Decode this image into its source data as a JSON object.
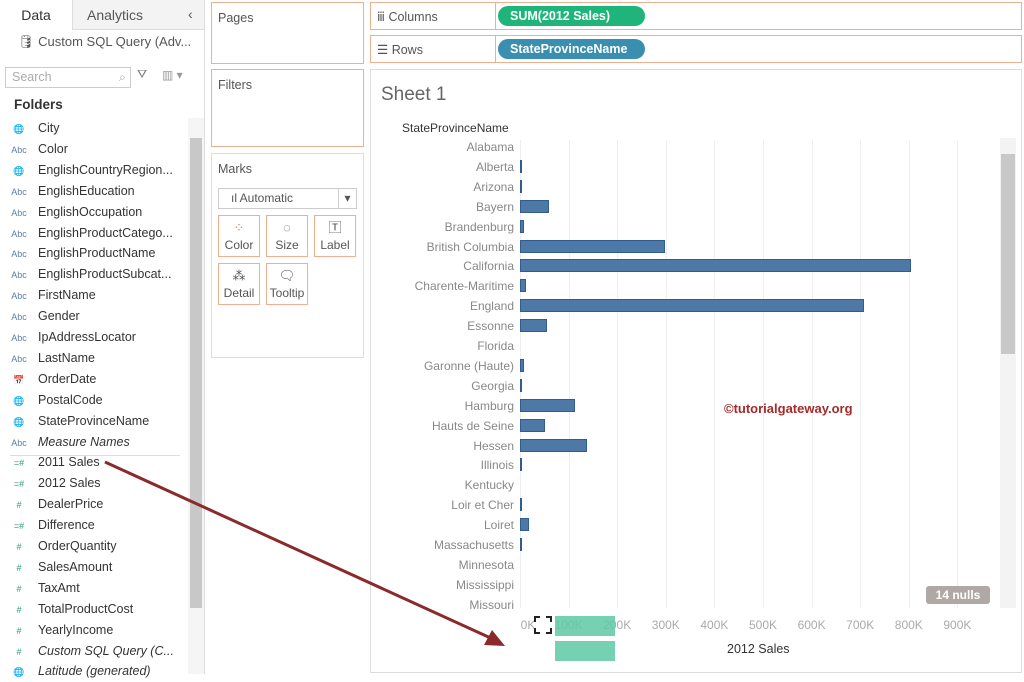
{
  "left": {
    "tabs": [
      "Data",
      "Analytics"
    ],
    "datasource": "Custom SQL Query (Adv...",
    "search_placeholder": "Search",
    "folders_label": "Folders",
    "fields": [
      {
        "icon": "globe",
        "name": "City",
        "type": "dim"
      },
      {
        "icon": "Abc",
        "name": "Color",
        "type": "dim"
      },
      {
        "icon": "globe",
        "name": "EnglishCountryRegion...",
        "type": "dim"
      },
      {
        "icon": "Abc",
        "name": "EnglishEducation",
        "type": "dim"
      },
      {
        "icon": "Abc",
        "name": "EnglishOccupation",
        "type": "dim"
      },
      {
        "icon": "Abc",
        "name": "EnglishProductCatego...",
        "type": "dim"
      },
      {
        "icon": "Abc",
        "name": "EnglishProductName",
        "type": "dim"
      },
      {
        "icon": "Abc",
        "name": "EnglishProductSubcat...",
        "type": "dim"
      },
      {
        "icon": "Abc",
        "name": "FirstName",
        "type": "dim"
      },
      {
        "icon": "Abc",
        "name": "Gender",
        "type": "dim"
      },
      {
        "icon": "Abc",
        "name": "IpAddressLocator",
        "type": "dim"
      },
      {
        "icon": "Abc",
        "name": "LastName",
        "type": "dim"
      },
      {
        "icon": "calendar",
        "name": "OrderDate",
        "type": "dim"
      },
      {
        "icon": "globe",
        "name": "PostalCode",
        "type": "dim"
      },
      {
        "icon": "globe",
        "name": "StateProvinceName",
        "type": "dim"
      },
      {
        "icon": "Abc",
        "name": "Measure Names",
        "type": "dim",
        "italic": true
      },
      {
        "icon": "=#",
        "name": "2011 Sales",
        "type": "meas"
      },
      {
        "icon": "=#",
        "name": "2012 Sales",
        "type": "meas"
      },
      {
        "icon": "#",
        "name": "DealerPrice",
        "type": "meas"
      },
      {
        "icon": "=#",
        "name": "Difference",
        "type": "meas"
      },
      {
        "icon": "#",
        "name": "OrderQuantity",
        "type": "meas"
      },
      {
        "icon": "#",
        "name": "SalesAmount",
        "type": "meas"
      },
      {
        "icon": "#",
        "name": "TaxAmt",
        "type": "meas"
      },
      {
        "icon": "#",
        "name": "TotalProductCost",
        "type": "meas"
      },
      {
        "icon": "#",
        "name": "YearlyIncome",
        "type": "meas"
      },
      {
        "icon": "#",
        "name": "Custom SQL Query (C...",
        "type": "meas",
        "italic": true
      },
      {
        "icon": "globe",
        "name": "Latitude (generated)",
        "type": "meas",
        "italic": true
      }
    ]
  },
  "cards": {
    "pages": "Pages",
    "filters": "Filters",
    "marks": "Marks",
    "mark_type": "Automatic",
    "buttons": [
      "Color",
      "Size",
      "Label",
      "Detail",
      "Tooltip"
    ]
  },
  "shelves": {
    "columns_label": "Columns",
    "columns_pill": "SUM(2012 Sales)",
    "rows_label": "Rows",
    "rows_pill": "StateProvinceName",
    "columns_color": "#1fb57a",
    "rows_color": "#3a8fb0"
  },
  "sheet": {
    "title": "Sheet 1",
    "watermark": "©tutorialgateway.org",
    "nulls": "14 nulls"
  },
  "chart_data": {
    "type": "bar",
    "orientation": "horizontal",
    "row_header": "StateProvinceName",
    "xlabel": "2012 Sales",
    "xlim": [
      0,
      950000
    ],
    "x_ticks": [
      "0K",
      "100K",
      "200K",
      "300K",
      "400K",
      "500K",
      "600K",
      "700K",
      "800K",
      "900K"
    ],
    "categories": [
      "Alabama",
      "Alberta",
      "Arizona",
      "Bayern",
      "Brandenburg",
      "British Columbia",
      "California",
      "Charente-Maritime",
      "England",
      "Essonne",
      "Florida",
      "Garonne (Haute)",
      "Georgia",
      "Hamburg",
      "Hauts de Seine",
      "Hessen",
      "Illinois",
      "Kentucky",
      "Loir et Cher",
      "Loiret",
      "Massachusetts",
      "Minnesota",
      "Mississippi",
      "Missouri"
    ],
    "values": [
      0,
      4000,
      1000,
      60000,
      8000,
      298000,
      805000,
      12000,
      708000,
      56000,
      0,
      8000,
      1000,
      113000,
      51000,
      138000,
      1000,
      0,
      4000,
      19000,
      1000,
      0,
      0,
      0
    ],
    "bar_color": "#4e79a7"
  }
}
